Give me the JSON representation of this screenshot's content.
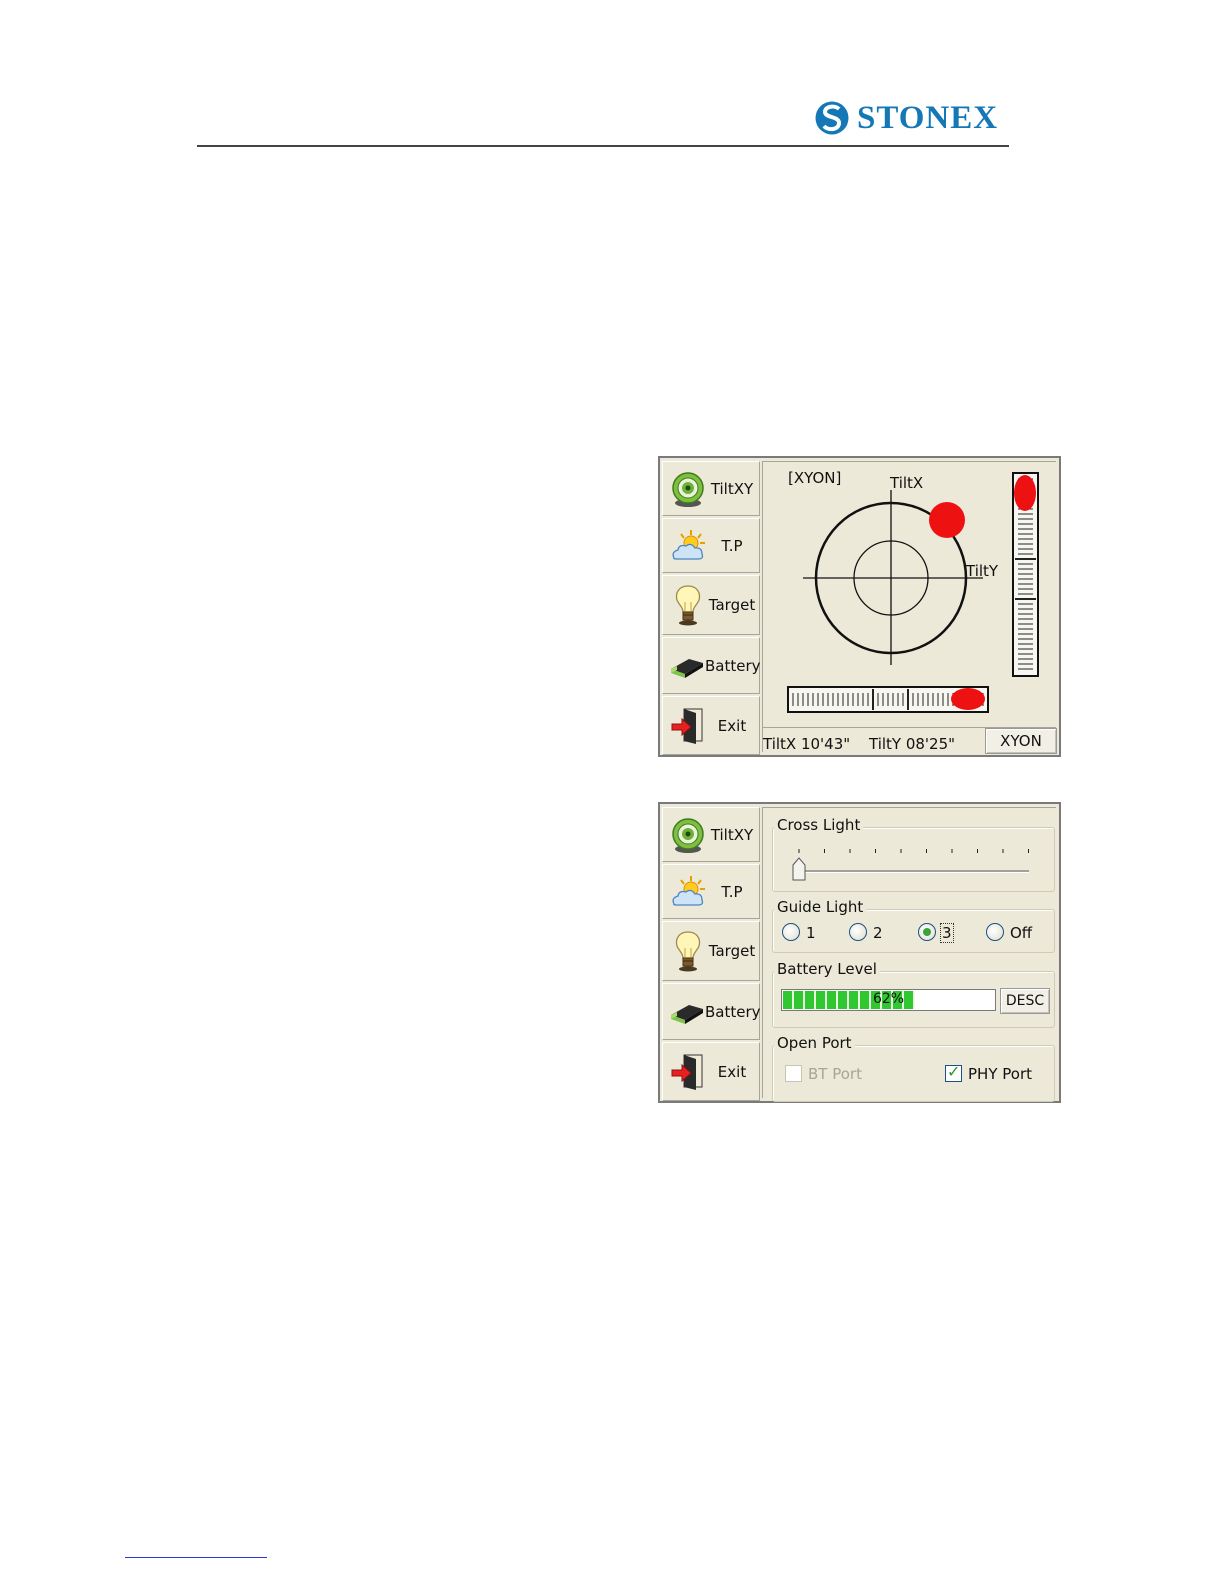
{
  "header": {
    "brand": "STONEX",
    "brand_color": "#1478b6"
  },
  "sidebar": {
    "items": [
      {
        "label": "TiltXY",
        "icon": "level-target-icon"
      },
      {
        "label": "T.P",
        "icon": "weather-sun-cloud-icon"
      },
      {
        "label": "Target",
        "icon": "light-bulb-icon"
      },
      {
        "label": "Battery",
        "icon": "battery-icon"
      },
      {
        "label": "Exit",
        "icon": "exit-door-icon"
      }
    ]
  },
  "tilt_screen": {
    "mode_label": "[XYON]",
    "axis_x_label": "TiltX",
    "axis_y_label": "TiltY",
    "status_tiltx": "TiltX 10'43\"",
    "status_tilty": "TiltY 08'25\"",
    "mode_button": "XYON",
    "bubble_color": "#ee1111"
  },
  "settings_screen": {
    "cross_light": {
      "title": "Cross Light",
      "level": 0
    },
    "guide_light": {
      "title": "Guide Light",
      "options": [
        "1",
        "2",
        "3",
        "Off"
      ],
      "selected": "3"
    },
    "battery_level": {
      "title": "Battery Level",
      "percent_text": "62%",
      "fraction": 0.62,
      "button": "DESC"
    },
    "open_port": {
      "title": "Open Port",
      "bt_port": {
        "label": "BT Port",
        "checked": false,
        "enabled": false
      },
      "phy_port": {
        "label": "PHY Port",
        "checked": true,
        "enabled": true
      }
    }
  }
}
